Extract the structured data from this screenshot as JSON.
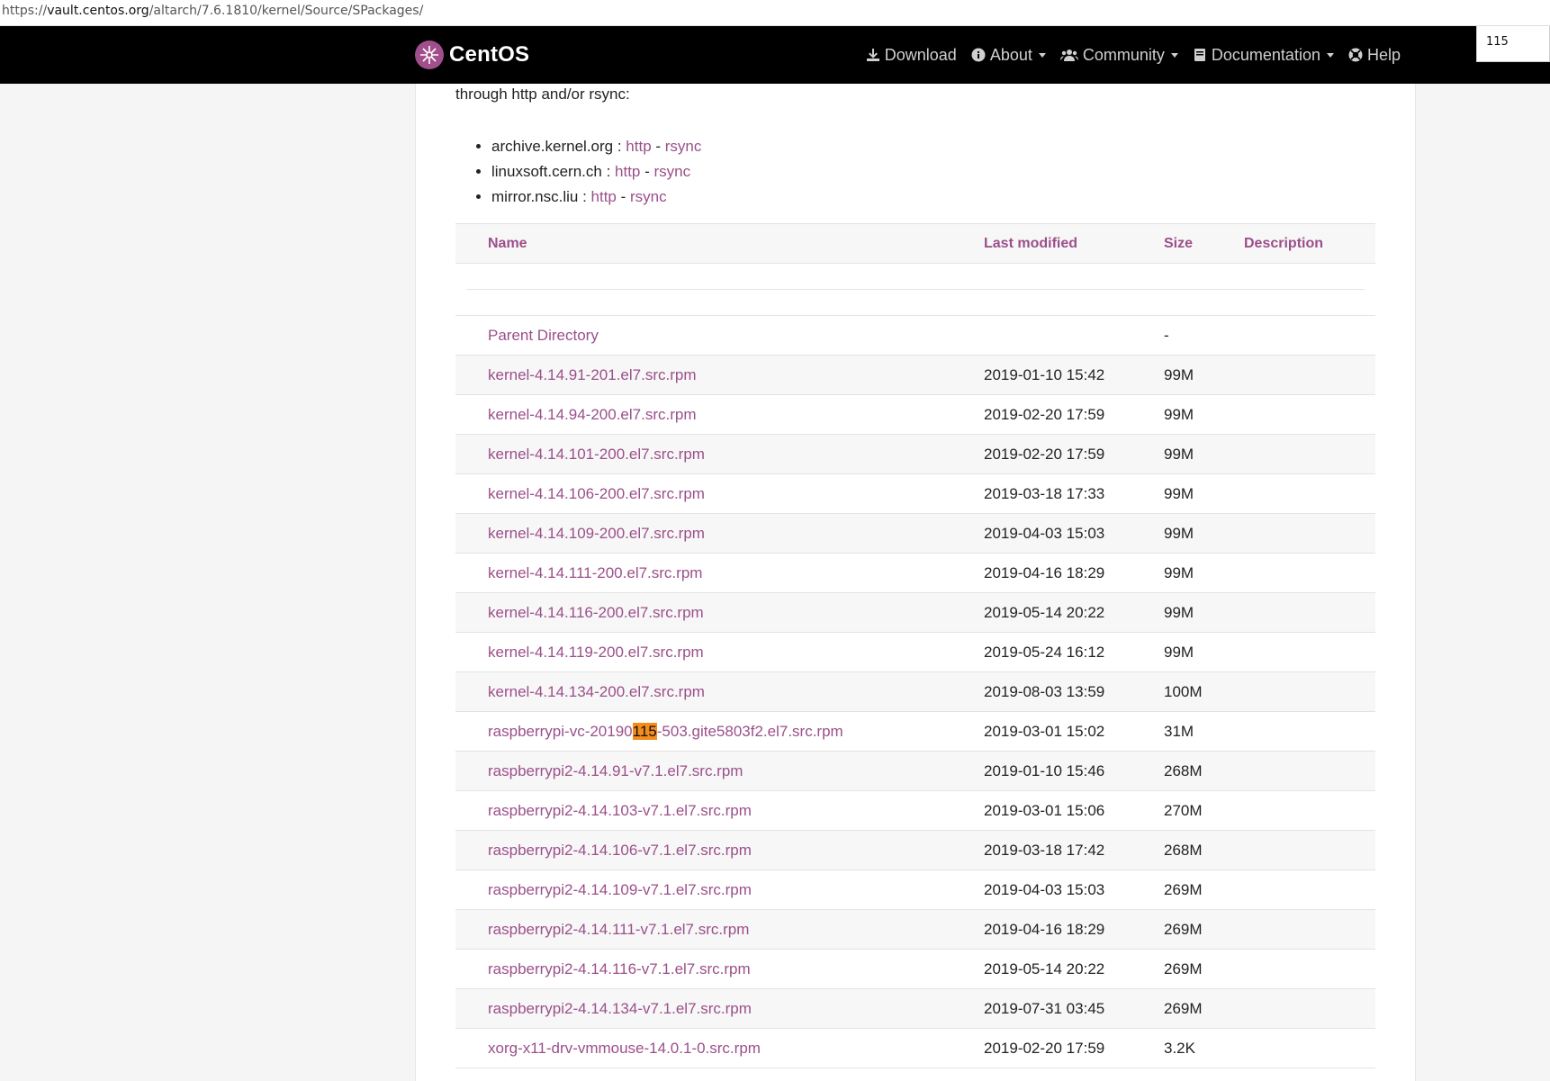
{
  "url": {
    "prefix": "https://",
    "host": "vault.centos.org",
    "path": "/altarch/7.6.1810/kernel/Source/SPackages/"
  },
  "find": {
    "query": "115"
  },
  "navbar": {
    "brand": "CentOS",
    "items": [
      {
        "label": "Download",
        "icon": "download-icon",
        "dropdown": false
      },
      {
        "label": "About",
        "icon": "info-icon",
        "dropdown": true
      },
      {
        "label": "Community",
        "icon": "users-icon",
        "dropdown": true
      },
      {
        "label": "Documentation",
        "icon": "book-icon",
        "dropdown": true
      },
      {
        "label": "Help",
        "icon": "lifebuoy-icon",
        "dropdown": false
      }
    ]
  },
  "intro": "through http and/or rsync:",
  "mirrors": [
    {
      "host": "archive.kernel.org",
      "sep": " : ",
      "http": "http",
      "dash": " - ",
      "rsync": "rsync"
    },
    {
      "host": "linuxsoft.cern.ch",
      "sep": " : ",
      "http": "http",
      "dash": " - ",
      "rsync": "rsync"
    },
    {
      "host": "mirror.nsc.liu",
      "sep": " : ",
      "http": "http",
      "dash": " - ",
      "rsync": "rsync"
    }
  ],
  "table": {
    "headers": {
      "name": "Name",
      "modified": "Last modified",
      "size": "Size",
      "description": "Description"
    },
    "rows": [
      {
        "name": "Parent Directory",
        "modified": "",
        "size": "-"
      },
      {
        "name": "kernel-4.14.91-201.el7.src.rpm",
        "modified": "2019-01-10 15:42",
        "size": "99M"
      },
      {
        "name": "kernel-4.14.94-200.el7.src.rpm",
        "modified": "2019-02-20 17:59",
        "size": "99M"
      },
      {
        "name": "kernel-4.14.101-200.el7.src.rpm",
        "modified": "2019-02-20 17:59",
        "size": "99M"
      },
      {
        "name": "kernel-4.14.106-200.el7.src.rpm",
        "modified": "2019-03-18 17:33",
        "size": "99M"
      },
      {
        "name": "kernel-4.14.109-200.el7.src.rpm",
        "modified": "2019-04-03 15:03",
        "size": "99M"
      },
      {
        "name": "kernel-4.14.111-200.el7.src.rpm",
        "modified": "2019-04-16 18:29",
        "size": "99M"
      },
      {
        "name": "kernel-4.14.116-200.el7.src.rpm",
        "modified": "2019-05-14 20:22",
        "size": "99M"
      },
      {
        "name": "kernel-4.14.119-200.el7.src.rpm",
        "modified": "2019-05-24 16:12",
        "size": "99M"
      },
      {
        "name": "kernel-4.14.134-200.el7.src.rpm",
        "modified": "2019-08-03 13:59",
        "size": "100M"
      },
      {
        "name_pre": "raspberrypi-vc-20190",
        "name_hl": "115",
        "name_post": "-503.gite5803f2.el7.src.rpm",
        "modified": "2019-03-01 15:02",
        "size": "31M"
      },
      {
        "name": "raspberrypi2-4.14.91-v7.1.el7.src.rpm",
        "modified": "2019-01-10 15:46",
        "size": "268M"
      },
      {
        "name": "raspberrypi2-4.14.103-v7.1.el7.src.rpm",
        "modified": "2019-03-01 15:06",
        "size": "270M"
      },
      {
        "name": "raspberrypi2-4.14.106-v7.1.el7.src.rpm",
        "modified": "2019-03-18 17:42",
        "size": "268M"
      },
      {
        "name": "raspberrypi2-4.14.109-v7.1.el7.src.rpm",
        "modified": "2019-04-03 15:03",
        "size": "269M"
      },
      {
        "name": "raspberrypi2-4.14.111-v7.1.el7.src.rpm",
        "modified": "2019-04-16 18:29",
        "size": "269M"
      },
      {
        "name": "raspberrypi2-4.14.116-v7.1.el7.src.rpm",
        "modified": "2019-05-14 20:22",
        "size": "269M"
      },
      {
        "name": "raspberrypi2-4.14.134-v7.1.el7.src.rpm",
        "modified": "2019-07-31 03:45",
        "size": "269M"
      },
      {
        "name": "xorg-x11-drv-vmmouse-14.0.1-0.src.rpm",
        "modified": "2019-02-20 17:59",
        "size": "3.2K"
      }
    ]
  },
  "colors": {
    "accent": "#9b4f8a",
    "navbar": "#000000",
    "highlight": "#f48c1e"
  }
}
